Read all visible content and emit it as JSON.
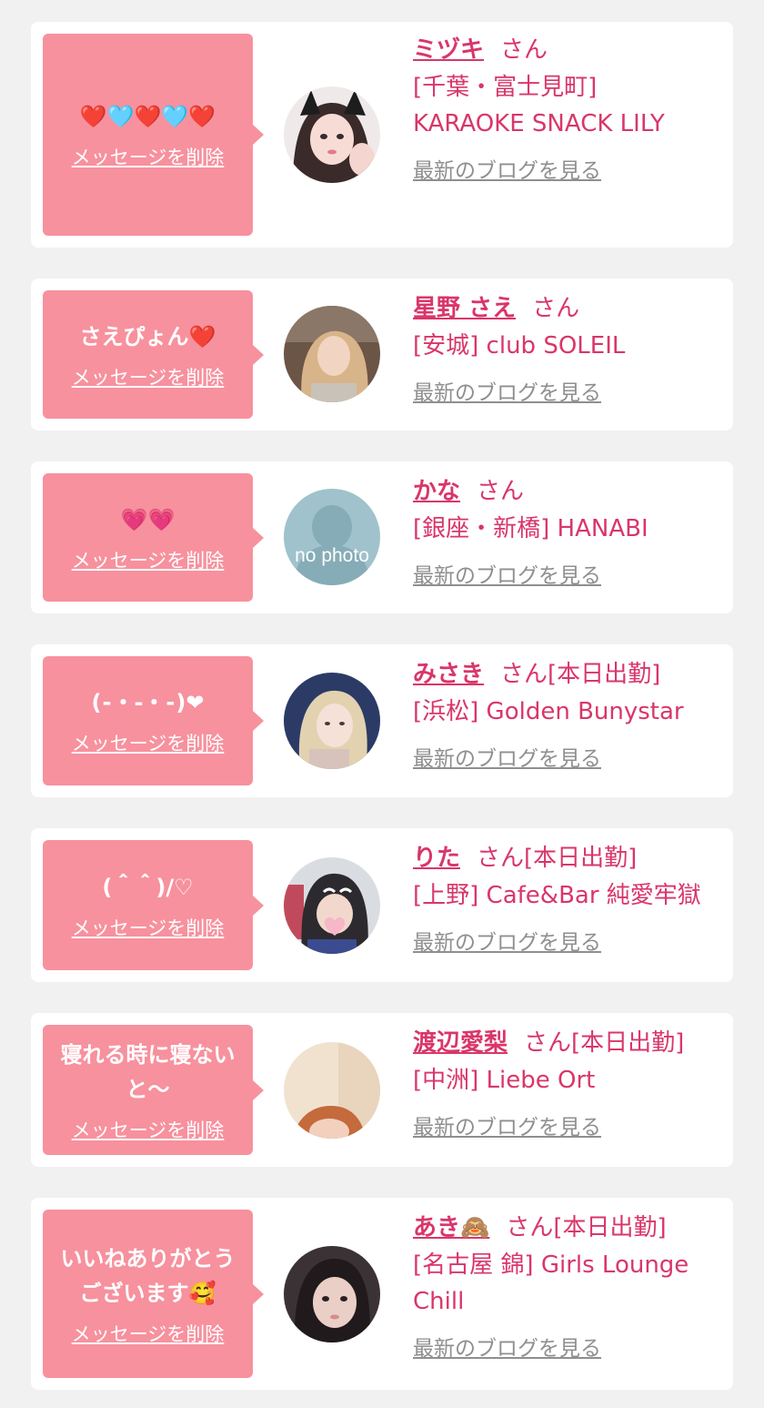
{
  "items": [
    {
      "message": "❤️🩵❤️🩵❤️",
      "delete_label": "メッセージを削除",
      "name": "ミヅキ",
      "honorific": "さん",
      "badge": "",
      "shop": "[千葉・富士見町] KARAOKE SNACK LILY",
      "blog_label": "最新のブログを見る"
    },
    {
      "message": "さえぴょん❤️",
      "delete_label": "メッセージを削除",
      "name": "星野 さえ",
      "honorific": "さん",
      "badge": "",
      "shop": "[安城] club SOLEIL",
      "blog_label": "最新のブログを見る"
    },
    {
      "message": "💗💗",
      "delete_label": "メッセージを削除",
      "name": "かな",
      "honorific": "さん",
      "badge": "",
      "shop": "[銀座・新橋] HANABI",
      "blog_label": "最新のブログを見る",
      "avatar_text": "no photo"
    },
    {
      "message": "(⁃・‐・⁃)❤",
      "delete_label": "メッセージを削除",
      "name": "みさき",
      "honorific": "さん",
      "badge": "[本日出勤]",
      "shop": "[浜松] Golden Bunystar",
      "blog_label": "最新のブログを見る"
    },
    {
      "message": "(＾＾)/♡",
      "delete_label": "メッセージを削除",
      "name": "りた",
      "honorific": "さん",
      "badge": "[本日出勤]",
      "shop": "[上野] Cafe&Bar 純愛牢獄",
      "blog_label": "最新のブログを見る"
    },
    {
      "message": "寝れる時に寝ないと〜",
      "delete_label": "メッセージを削除",
      "name": "渡辺愛梨",
      "honorific": "さん",
      "badge": "[本日出勤]",
      "shop": "[中洲] Liebe Ort",
      "blog_label": "最新のブログを見る"
    },
    {
      "message": "いいねありがとうございます🥰",
      "delete_label": "メッセージを削除",
      "name": "あき🙈",
      "honorific": "さん",
      "badge": "[本日出勤]",
      "shop": "[名古屋 錦] Girls Lounge Chill",
      "blog_label": "最新のブログを見る"
    }
  ],
  "colors": {
    "bubble": "#f7919e",
    "accent": "#d9366a",
    "link_gray": "#8f8f8f",
    "background": "#f1f1f1"
  }
}
